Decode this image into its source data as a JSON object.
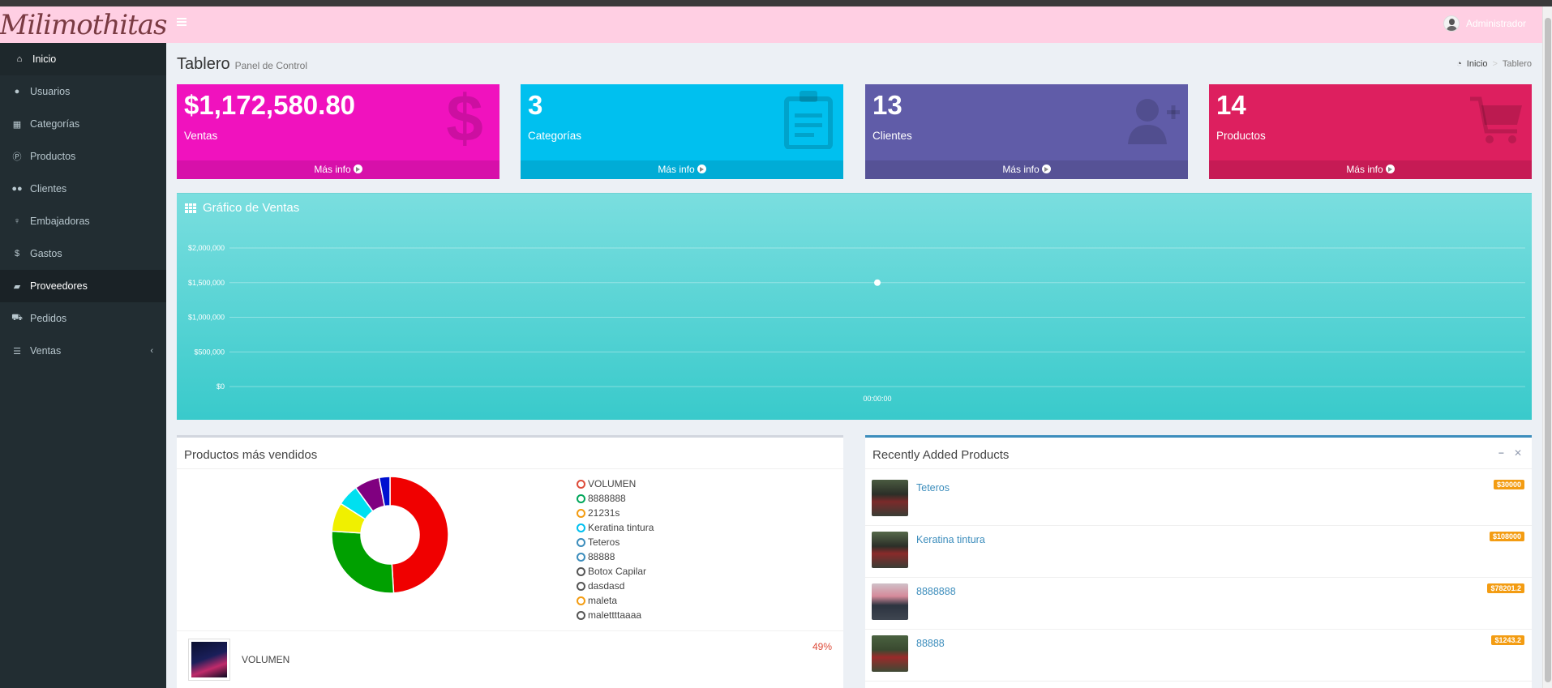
{
  "header": {
    "logo_text": "Milimothitas",
    "user_name": "Administrador"
  },
  "sidebar": {
    "items": [
      {
        "label": "Inicio",
        "icon": "home-icon"
      },
      {
        "label": "Usuarios",
        "icon": "user-icon"
      },
      {
        "label": "Categorías",
        "icon": "th-icon"
      },
      {
        "label": "Productos",
        "icon": "product-hunt-icon"
      },
      {
        "label": "Clientes",
        "icon": "users-icon"
      },
      {
        "label": "Embajadoras",
        "icon": "female-icon"
      },
      {
        "label": "Gastos",
        "icon": "dollar-icon"
      },
      {
        "label": "Proveedores",
        "icon": "book-icon"
      },
      {
        "label": "Pedidos",
        "icon": "cart-icon"
      },
      {
        "label": "Ventas",
        "icon": "list-icon"
      }
    ]
  },
  "page": {
    "title": "Tablero",
    "subtitle": "Panel de Control",
    "breadcrumb": {
      "home": "Inicio",
      "current": "Tablero"
    }
  },
  "stats": [
    {
      "value": "$1,172,580.80",
      "label": "Ventas",
      "more": "Más info",
      "color": "#f012be",
      "icon": "dollar-icon"
    },
    {
      "value": "3",
      "label": "Categorías",
      "more": "Más info",
      "color": "#00c0ef",
      "icon": "clipboard-icon"
    },
    {
      "value": "13",
      "label": "Clientes",
      "more": "Más info",
      "color": "#605ca8",
      "icon": "user-plus-icon"
    },
    {
      "value": "14",
      "label": "Productos",
      "more": "Más info",
      "color": "#dd1f5f",
      "icon": "cart-icon"
    }
  ],
  "sales_chart": {
    "title": "Gráfico de Ventas",
    "chart_data": {
      "type": "line",
      "x": [
        "00:00:00"
      ],
      "series": [
        {
          "values": [
            1500000
          ]
        }
      ],
      "y_ticks": [
        "$0",
        "$500,000",
        "$1,000,000",
        "$1,500,000",
        "$2,000,000"
      ],
      "ylim": [
        0,
        2000000
      ],
      "grid": true
    }
  },
  "top_products": {
    "title": "Productos más vendidos",
    "chart_data": {
      "type": "pie",
      "categories": [
        "VOLUMEN",
        "8888888",
        "21231s",
        "Keratina tintura",
        "Teteros",
        "88888",
        "Botox Capilar",
        "dasdasd",
        "maleta",
        "malettttaaaa"
      ],
      "values": [
        49,
        27,
        8,
        6,
        7,
        3,
        0,
        0,
        0,
        0
      ],
      "colors": [
        "#f00000",
        "#00a000",
        "#f0f000",
        "#00e0f0",
        "#800080",
        "#0010d0",
        "#444444",
        "#444444",
        "#f39c12",
        "#444444"
      ],
      "legend_colors": [
        "#dd4b39",
        "#00a65a",
        "#f39c12",
        "#00c0ef",
        "#3c8dbc",
        "#3c8dbc",
        "#555555",
        "#555555",
        "#f39c12",
        "#555555"
      ]
    },
    "list": [
      {
        "name": "VOLUMEN",
        "percent": "49%"
      }
    ]
  },
  "recent_products": {
    "title": "Recently Added Products",
    "items": [
      {
        "name": "Teteros",
        "price": "$30000"
      },
      {
        "name": "Keratina tintura",
        "price": "$108000"
      },
      {
        "name": "8888888",
        "price": "$78201.2"
      },
      {
        "name": "88888",
        "price": "$1243.2"
      }
    ]
  }
}
